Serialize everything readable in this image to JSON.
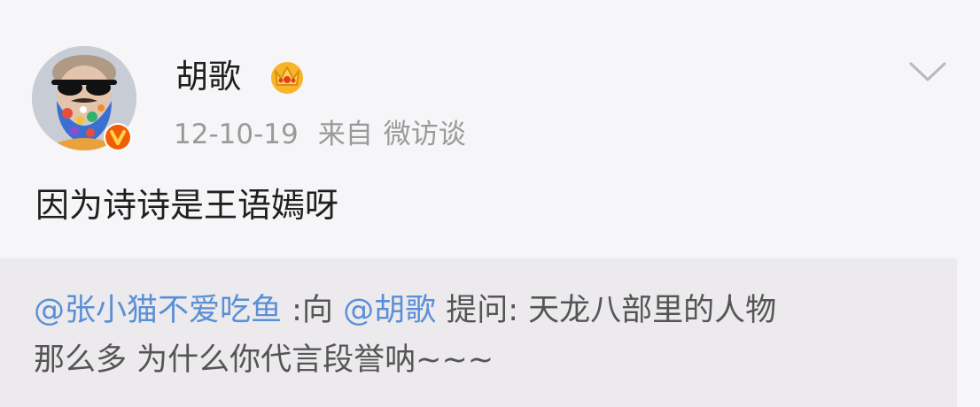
{
  "post": {
    "username": "胡歌",
    "date": "12-10-19",
    "source_prefix": "来自",
    "source_app": "微访谈",
    "text": "因为诗诗是王语嫣呀",
    "avatar_icon": "bearded-man-sunglasses-avatar",
    "verified_icon": "verified-v-badge",
    "vip_icon": "vip-crown-icon",
    "more_icon": "chevron-down-icon",
    "colors": {
      "verified": "#f25c05",
      "crown": "#f7b52c",
      "mention": "#5b8fd6"
    }
  },
  "quote": {
    "asker_mention": "@张小猫不爱吃鱼",
    "to_text": " :向 ",
    "target_mention": "@胡歌",
    "question_line1": " 提问: 天龙八部里的人物",
    "question_line2": "那么多 为什么你代言段誉呐~~~"
  }
}
